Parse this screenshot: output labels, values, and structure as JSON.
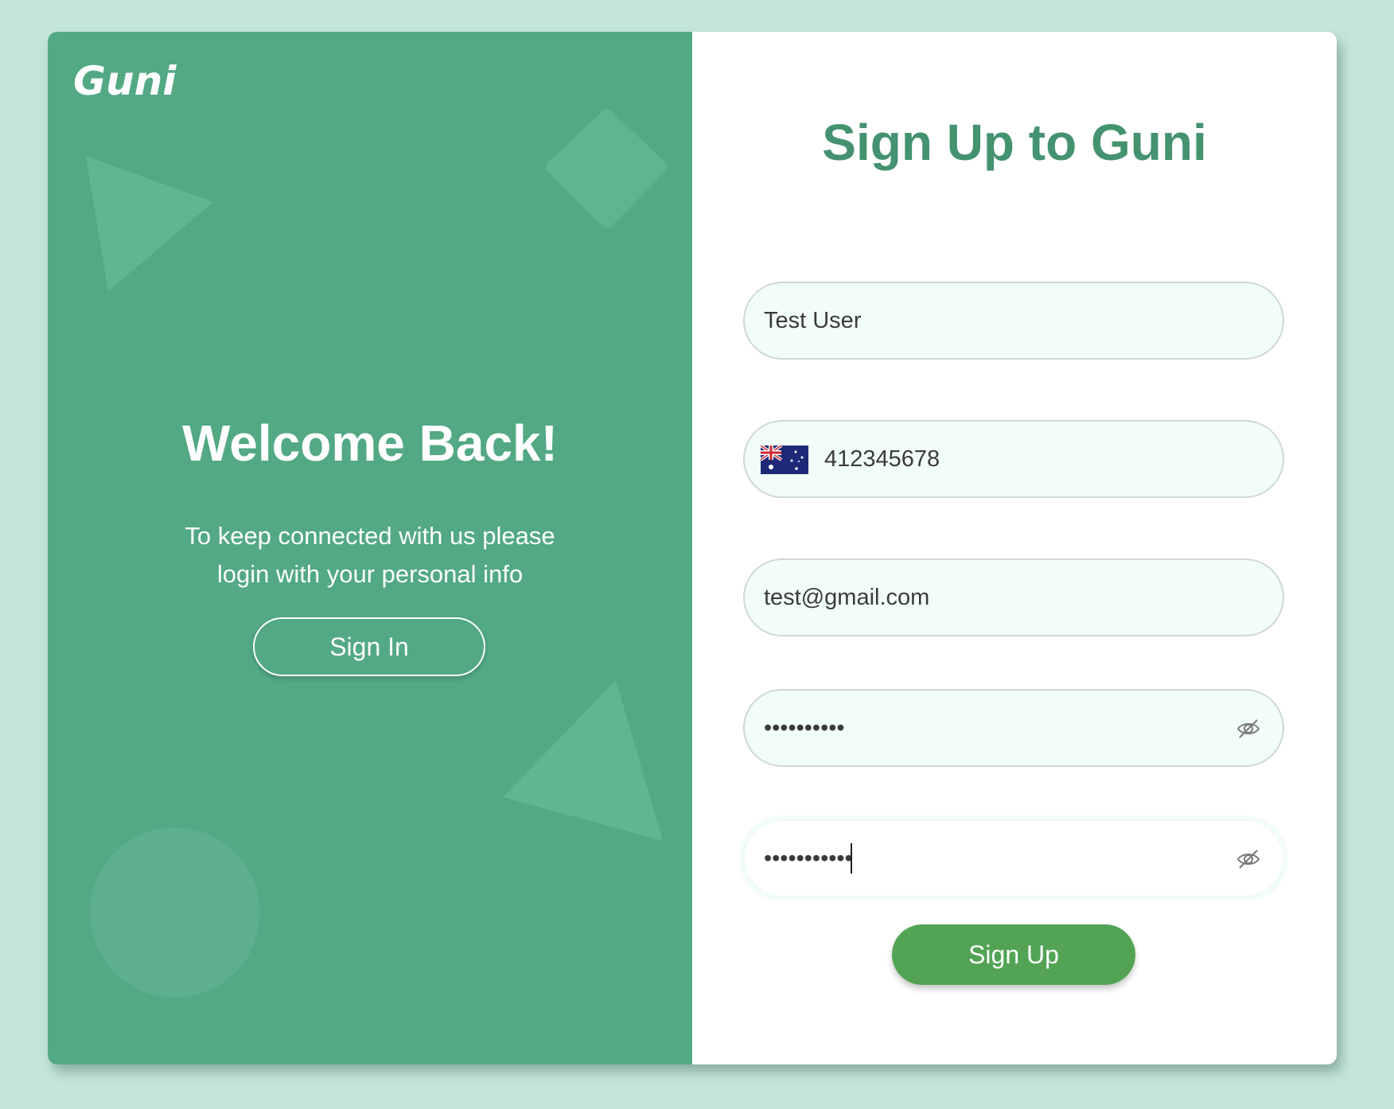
{
  "brand": {
    "logo_text": "Guni"
  },
  "left_panel": {
    "title": "Welcome Back!",
    "message": "To keep connected with us please login with your personal info",
    "signin_label": "Sign In"
  },
  "form": {
    "title": "Sign Up to Guni",
    "name_value": "Test User",
    "phone_country": "Australia",
    "phone_value": "412345678",
    "email_value": "test@gmail.com",
    "password_value": "••••••••••",
    "confirm_password_value": "•••••••••••",
    "password_toggle_icon": "eye-slash-icon",
    "signup_label": "Sign Up"
  },
  "colors": {
    "page_background": "#c4e5da",
    "left_panel": "#52a984",
    "title_green": "#44926f",
    "button_green": "#52a454",
    "field_background": "#f1fdf9"
  }
}
